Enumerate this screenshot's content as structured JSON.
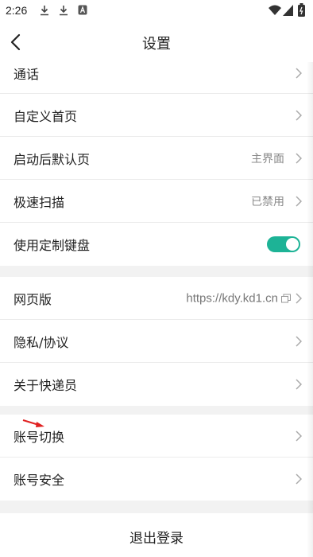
{
  "status_bar": {
    "time": "2:26",
    "icons": [
      "download-icon",
      "download-icon",
      "app-notification-icon",
      "wifi-icon",
      "signal-icon",
      "battery-icon"
    ]
  },
  "nav": {
    "title": "设置",
    "back_icon": "chevron-left-icon"
  },
  "groups": [
    {
      "rows": [
        {
          "label": "通话",
          "value": "",
          "control": "chevron"
        },
        {
          "label": "自定义首页",
          "value": "",
          "control": "chevron"
        },
        {
          "label": "启动后默认页",
          "value": "主界面",
          "control": "chevron"
        },
        {
          "label": "极速扫描",
          "value": "已禁用",
          "control": "chevron"
        },
        {
          "label": "使用定制键盘",
          "value": "",
          "control": "toggle",
          "toggle_on": true
        }
      ]
    },
    {
      "rows": [
        {
          "label": "网页版",
          "value": "https://kdy.kd1.cn",
          "control": "copy-chevron"
        },
        {
          "label": "隐私/协议",
          "value": "",
          "control": "chevron"
        },
        {
          "label": "关于快递员",
          "value": "",
          "control": "chevron"
        }
      ]
    },
    {
      "rows": [
        {
          "label": "账号切换",
          "value": "",
          "control": "chevron"
        },
        {
          "label": "账号安全",
          "value": "",
          "control": "chevron"
        }
      ]
    }
  ],
  "logout": {
    "label": "退出登录"
  },
  "colors": {
    "accent": "#1db396",
    "background": "#f2f2f2",
    "annotation_arrow": "#e02020"
  }
}
